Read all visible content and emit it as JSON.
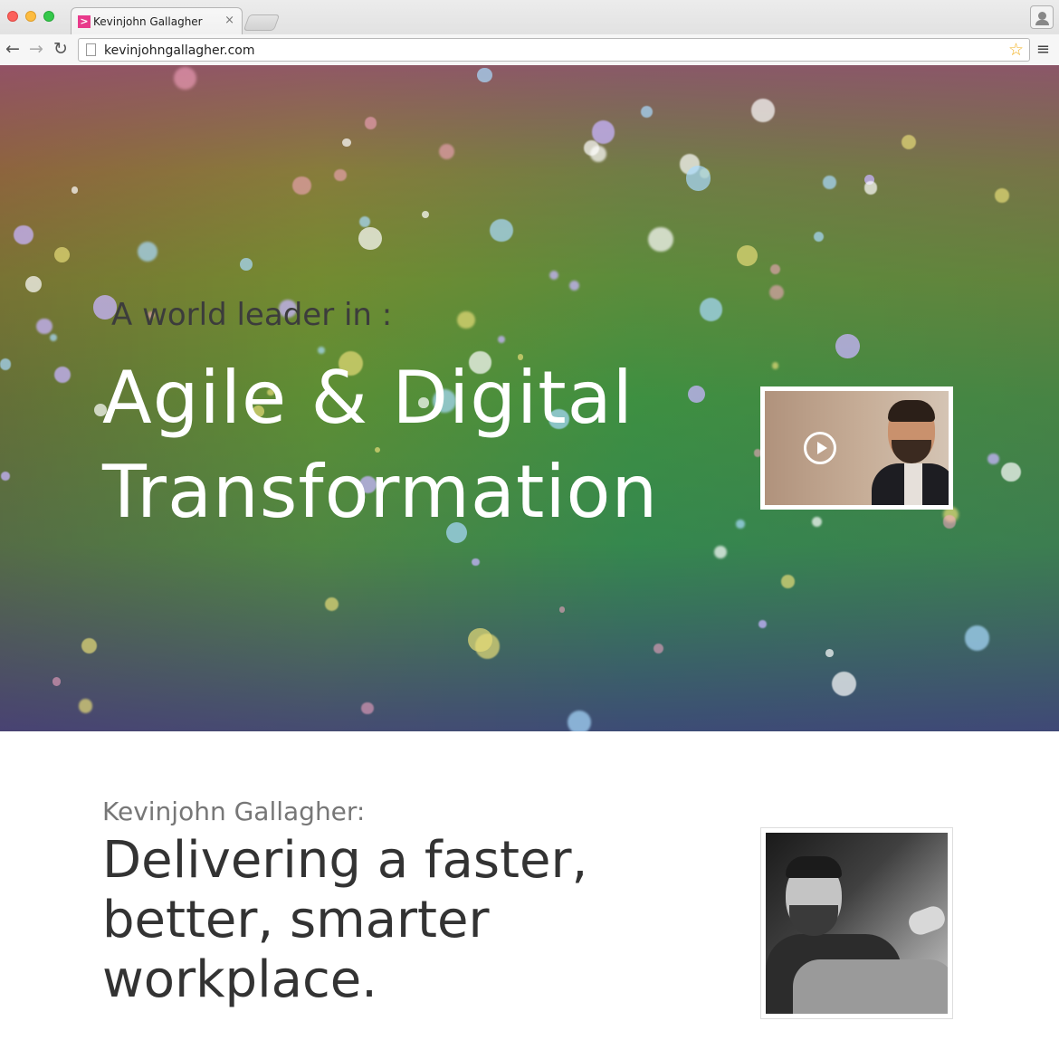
{
  "browser": {
    "tab_title": "Kevinjohn Gallagher",
    "tab_close": "×",
    "favicon_glyph": ">",
    "url": "kevinjohngallagher.com",
    "back_glyph": "←",
    "forward_glyph": "→",
    "reload_glyph": "↻",
    "star_glyph": "☆",
    "menu_glyph": "≡"
  },
  "hero": {
    "lead": "A world leader in :",
    "headline_line1": "Agile & Digital",
    "headline_line2": "Transformation",
    "video_thumbnail": "play-video"
  },
  "intro": {
    "label": "Kevinjohn Gallagher:",
    "headline_line1": "Delivering a faster,",
    "headline_line2": "better, smarter",
    "headline_line3": "workplace."
  },
  "colors": {
    "favicon": "#e83a8b",
    "headline": "#ffffff",
    "body_text": "#333333"
  }
}
